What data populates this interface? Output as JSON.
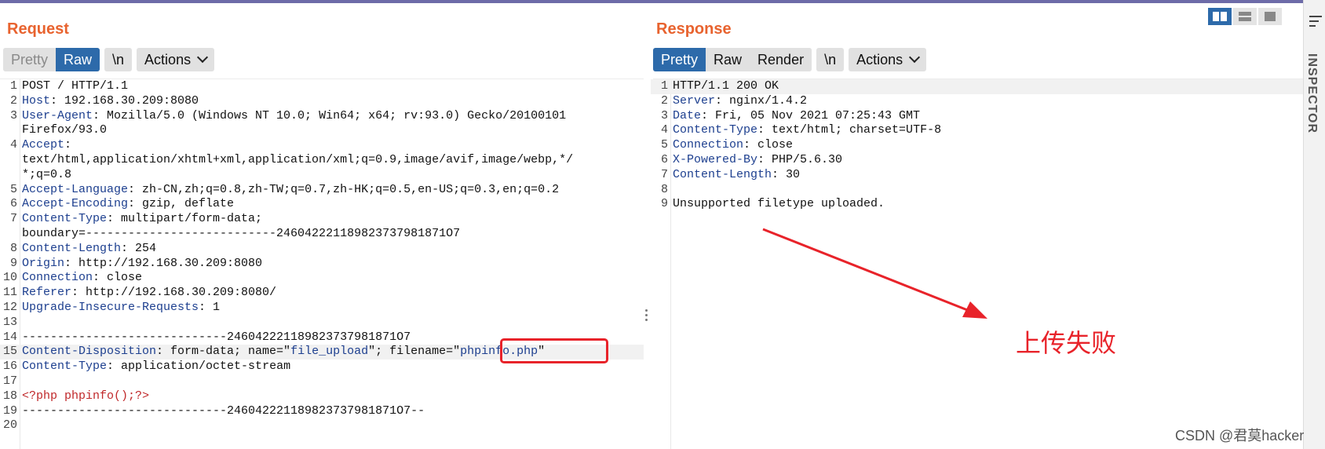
{
  "request": {
    "title": "Request",
    "tabs": [
      "Pretty",
      "Raw"
    ],
    "newline_label": "\\n",
    "actions_label": "Actions",
    "lines": [
      {
        "n": "1",
        "parts": [
          {
            "t": "POST / HTTP/1.1",
            "c": "txt"
          }
        ]
      },
      {
        "n": "2",
        "parts": [
          {
            "t": "Host",
            "c": "key"
          },
          {
            "t": ": 192.168.30.209:8080",
            "c": "txt"
          }
        ]
      },
      {
        "n": "3",
        "parts": [
          {
            "t": "User-Agent",
            "c": "key"
          },
          {
            "t": ": Mozilla/5.0 (Windows NT 10.0; Win64; x64; rv:93.0) Gecko/20100101",
            "c": "txt"
          }
        ]
      },
      {
        "n": "",
        "parts": [
          {
            "t": "Firefox/93.0",
            "c": "txt"
          }
        ]
      },
      {
        "n": "4",
        "parts": [
          {
            "t": "Accept",
            "c": "key"
          },
          {
            "t": ":",
            "c": "txt"
          }
        ]
      },
      {
        "n": "",
        "parts": [
          {
            "t": "text/html,application/xhtml+xml,application/xml;q=0.9,image/avif,image/webp,*/",
            "c": "txt"
          }
        ]
      },
      {
        "n": "",
        "parts": [
          {
            "t": "*;q=0.8",
            "c": "txt"
          }
        ]
      },
      {
        "n": "5",
        "parts": [
          {
            "t": "Accept-Language",
            "c": "key"
          },
          {
            "t": ": zh-CN,zh;q=0.8,zh-TW;q=0.7,zh-HK;q=0.5,en-US;q=0.3,en;q=0.2",
            "c": "txt"
          }
        ]
      },
      {
        "n": "6",
        "parts": [
          {
            "t": "Accept-Encoding",
            "c": "key"
          },
          {
            "t": ": gzip, deflate",
            "c": "txt"
          }
        ]
      },
      {
        "n": "7",
        "parts": [
          {
            "t": "Content-Type",
            "c": "key"
          },
          {
            "t": ": multipart/form-data;",
            "c": "txt"
          }
        ]
      },
      {
        "n": "",
        "parts": [
          {
            "t": "boundary=---------------------------246042221189823737981871O7",
            "c": "txt"
          }
        ]
      },
      {
        "n": "8",
        "parts": [
          {
            "t": "Content-Length",
            "c": "key"
          },
          {
            "t": ": 254",
            "c": "txt"
          }
        ]
      },
      {
        "n": "9",
        "parts": [
          {
            "t": "Origin",
            "c": "key"
          },
          {
            "t": ": http://192.168.30.209:8080",
            "c": "txt"
          }
        ]
      },
      {
        "n": "10",
        "parts": [
          {
            "t": "Connection",
            "c": "key"
          },
          {
            "t": ": close",
            "c": "txt"
          }
        ]
      },
      {
        "n": "11",
        "parts": [
          {
            "t": "Referer",
            "c": "key"
          },
          {
            "t": ": http://192.168.30.209:8080/",
            "c": "txt"
          }
        ]
      },
      {
        "n": "12",
        "parts": [
          {
            "t": "Upgrade-Insecure-Requests",
            "c": "key"
          },
          {
            "t": ": 1",
            "c": "txt"
          }
        ]
      },
      {
        "n": "13",
        "parts": [
          {
            "t": "",
            "c": "txt"
          }
        ]
      },
      {
        "n": "14",
        "parts": [
          {
            "t": "-----------------------------246042221189823737981871O7",
            "c": "txt"
          }
        ]
      },
      {
        "n": "15",
        "hl": true,
        "parts": [
          {
            "t": "Content-Disposition",
            "c": "key"
          },
          {
            "t": ": form-data; name=\"",
            "c": "txt"
          },
          {
            "t": "file_upload",
            "c": "str"
          },
          {
            "t": "\"; filename=\"",
            "c": "txt"
          },
          {
            "t": "phpinfo.php",
            "c": "str"
          },
          {
            "t": "\"",
            "c": "txt"
          }
        ]
      },
      {
        "n": "16",
        "parts": [
          {
            "t": "Content-Type",
            "c": "key"
          },
          {
            "t": ": application/octet-stream",
            "c": "txt"
          }
        ]
      },
      {
        "n": "17",
        "parts": [
          {
            "t": "",
            "c": "txt"
          }
        ]
      },
      {
        "n": "18",
        "parts": [
          {
            "t": "<?php phpinfo();?>",
            "c": "php"
          }
        ]
      },
      {
        "n": "19",
        "parts": [
          {
            "t": "-----------------------------246042221189823737981871O7--",
            "c": "txt"
          }
        ]
      },
      {
        "n": "20",
        "parts": [
          {
            "t": "",
            "c": "txt"
          }
        ]
      }
    ]
  },
  "response": {
    "title": "Response",
    "tabs": [
      "Pretty",
      "Raw",
      "Render"
    ],
    "newline_label": "\\n",
    "actions_label": "Actions",
    "lines": [
      {
        "n": "1",
        "hl": true,
        "parts": [
          {
            "t": "HTTP/1.1 200 OK",
            "c": "txt"
          }
        ]
      },
      {
        "n": "2",
        "parts": [
          {
            "t": "Server",
            "c": "key"
          },
          {
            "t": ": nginx/1.4.2",
            "c": "txt"
          }
        ]
      },
      {
        "n": "3",
        "parts": [
          {
            "t": "Date",
            "c": "key"
          },
          {
            "t": ": Fri, 05 Nov 2021 07:25:43 GMT",
            "c": "txt"
          }
        ]
      },
      {
        "n": "4",
        "parts": [
          {
            "t": "Content-Type",
            "c": "key"
          },
          {
            "t": ": text/html; charset=UTF-8",
            "c": "txt"
          }
        ]
      },
      {
        "n": "5",
        "parts": [
          {
            "t": "Connection",
            "c": "key"
          },
          {
            "t": ": close",
            "c": "txt"
          }
        ]
      },
      {
        "n": "6",
        "parts": [
          {
            "t": "X-Powered-By",
            "c": "key"
          },
          {
            "t": ": PHP/5.6.30",
            "c": "txt"
          }
        ]
      },
      {
        "n": "7",
        "parts": [
          {
            "t": "Content-Length",
            "c": "key"
          },
          {
            "t": ": 30",
            "c": "txt"
          }
        ]
      },
      {
        "n": "8",
        "parts": [
          {
            "t": "",
            "c": "txt"
          }
        ]
      },
      {
        "n": "9",
        "parts": [
          {
            "t": "Unsupported filetype uploaded.",
            "c": "txt"
          }
        ]
      }
    ]
  },
  "sidebar": {
    "inspector_label": "INSPECTOR"
  },
  "annotation": {
    "text": "上传失败"
  },
  "watermark": "CSDN @君莫hacker",
  "colors": {
    "accent": "#2d6aaa",
    "title": "#e8632f",
    "annotation": "#e8232a",
    "key": "#1d3f8f"
  }
}
